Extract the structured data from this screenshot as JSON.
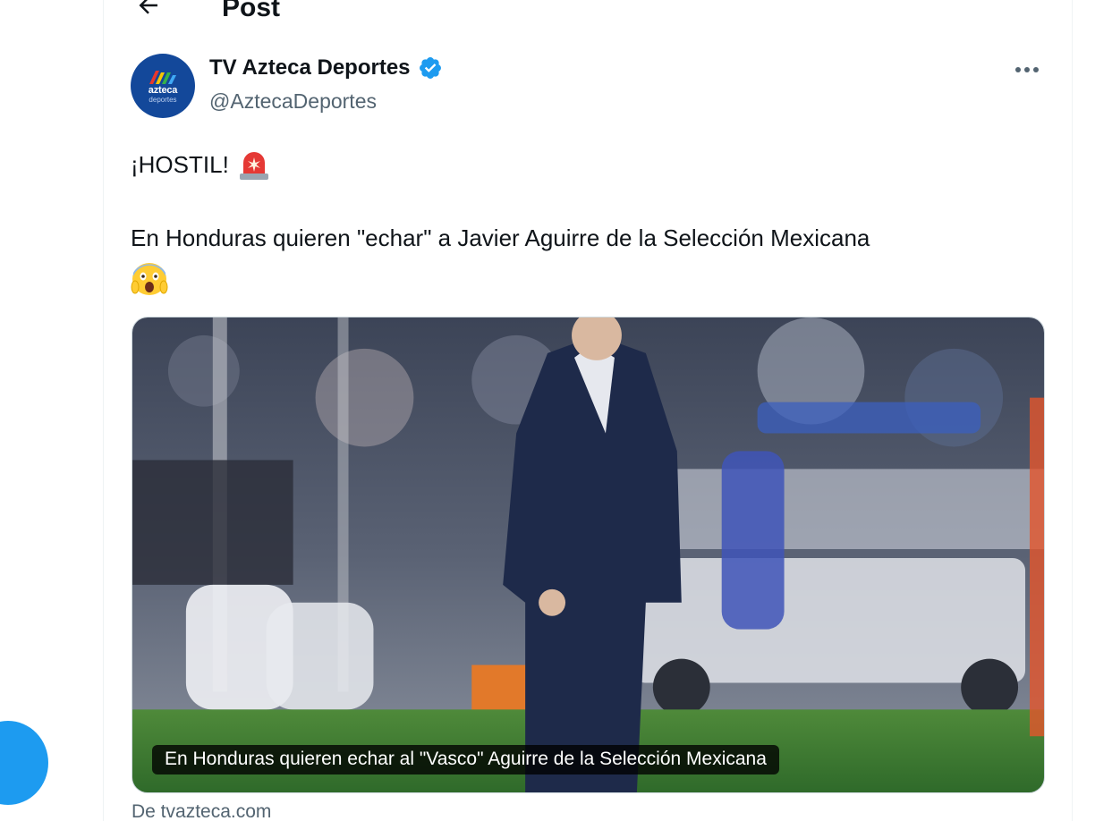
{
  "header": {
    "title": "Post",
    "back_icon": "arrow-left-icon"
  },
  "tweet": {
    "author": {
      "name": "TV Azteca Deportes",
      "handle": "@AztecaDeportes",
      "verified": true,
      "avatar_logo_text": "azteca",
      "avatar_logo_sub": "deportes"
    },
    "more_icon": "more-horizontal-icon",
    "text_line_1": "¡HOSTIL!",
    "text_line_1_emoji": "police-light-emoji",
    "text_line_2": "En Honduras quieren \"echar\" a Javier Aguirre de la Selección Mexicana",
    "text_line_2_emoji": "screaming-face-emoji",
    "card": {
      "caption": "En Honduras quieren echar al \"Vasco\" Aguirre de la Selección Mexicana",
      "source": "De tvazteca.com"
    }
  },
  "colors": {
    "accent": "#1d9bf0",
    "secondary_text": "#536471",
    "avatar_bg": "#13489a"
  }
}
